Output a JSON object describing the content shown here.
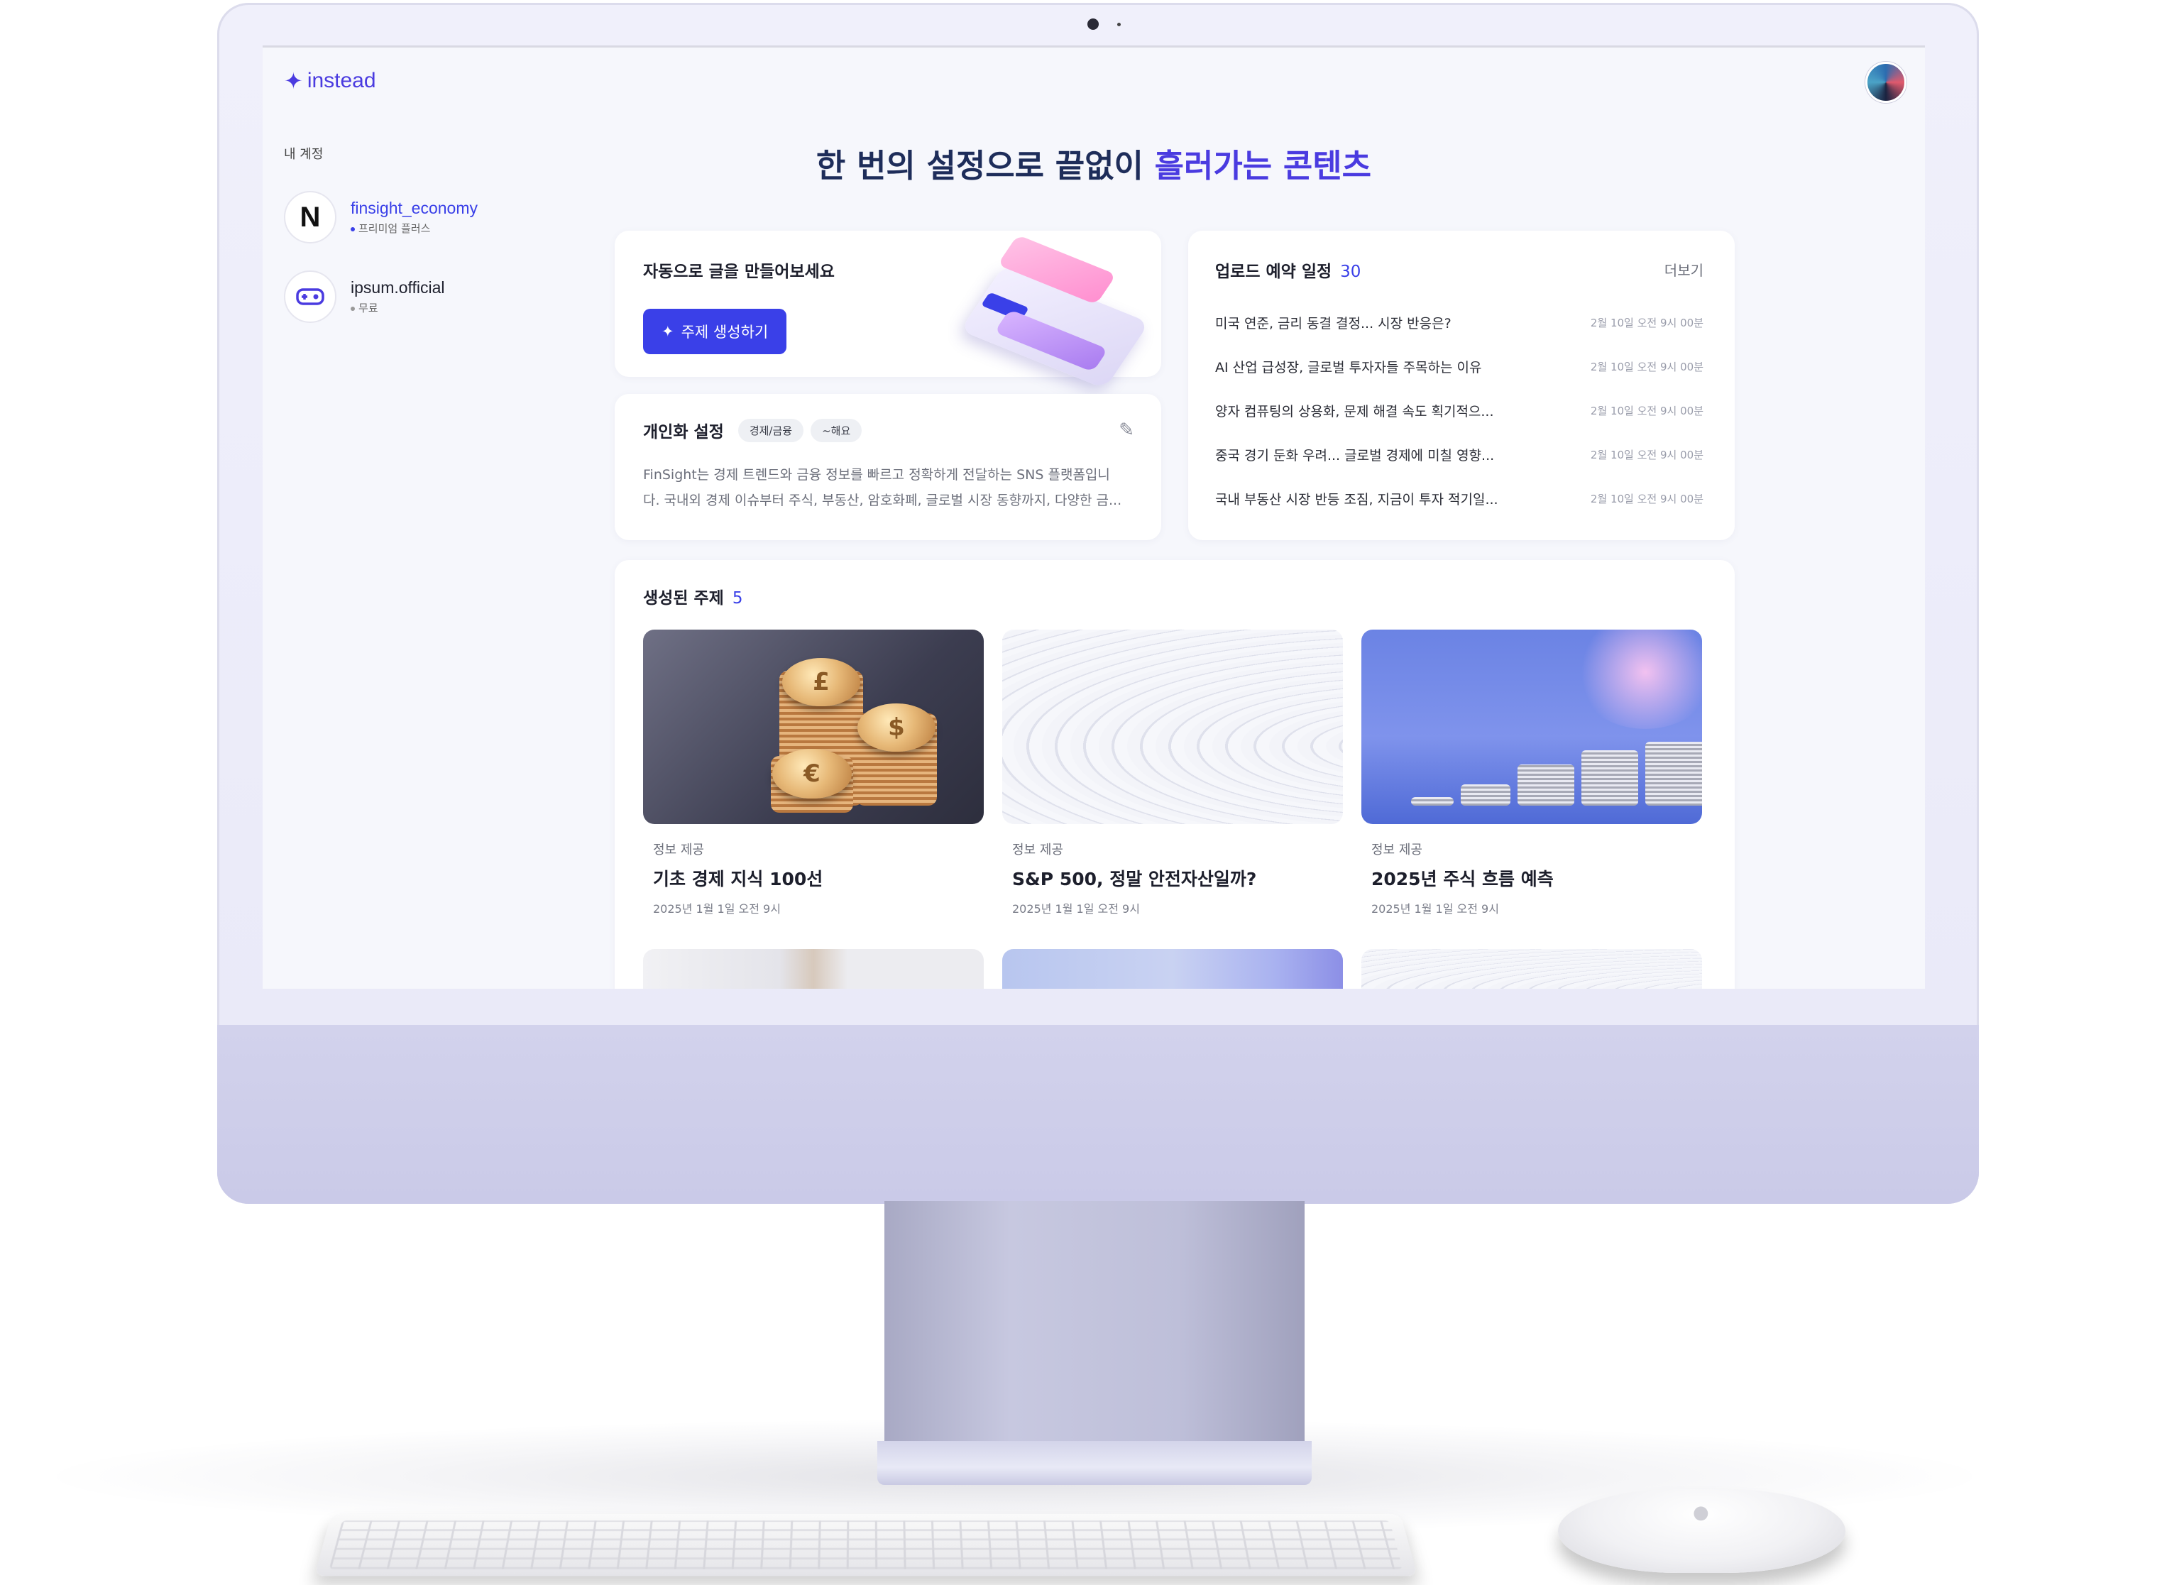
{
  "app": {
    "logo_text": "instead",
    "headline_part1": "한 번의 설정으로 끝없이 ",
    "headline_part2": "흘러가는 콘텐츠"
  },
  "sidebar": {
    "section_label": "내 계정",
    "accounts": [
      {
        "name": "finsight_economy",
        "plan": "프리미엄 플러스",
        "icon": "N",
        "active": true
      },
      {
        "name": "ipsum.official",
        "plan": "무료",
        "icon": "game-controller-icon",
        "active": false
      }
    ]
  },
  "auto_card": {
    "title": "자동으로 글을 만들어보세요",
    "button_label": "주제 생성하기"
  },
  "personal_card": {
    "title": "개인화 설정",
    "chips": [
      "경제/금융",
      "~해요"
    ],
    "desc_line1": "FinSight는 경제 트렌드와 금융 정보를 빠르고 정확하게 전달하는 SNS 플랫폼입니",
    "desc_line2": "다. 국내외 경제 이슈부터 주식, 부동산, 암호화폐, 글로벌 시장 동향까지, 다양한 금..."
  },
  "schedule": {
    "title": "업로드 예약 일정",
    "count": "30",
    "more_label": "더보기",
    "items": [
      {
        "title": "미국 연준, 금리 동결 결정... 시장 반응은?",
        "time": "2월 10일 오전 9시 00분"
      },
      {
        "title": "AI 산업 급성장, 글로벌 투자자들 주목하는 이유",
        "time": "2월 10일 오전 9시 00분"
      },
      {
        "title": "양자 컴퓨팅의 상용화, 문제 해결 속도 획기적으...",
        "time": "2월 10일 오전 9시 00분"
      },
      {
        "title": "중국 경기 둔화 우려... 글로벌 경제에 미칠 영향...",
        "time": "2월 10일 오전 9시 00분"
      },
      {
        "title": "국내 부동산 시장 반등 조짐, 지금이 투자 적기일...",
        "time": "2월 10일 오전 9시 00분"
      }
    ]
  },
  "topics": {
    "title": "생성된 주제",
    "count": "5",
    "items": [
      {
        "category": "정보 제공",
        "title": "기초 경제 지식 100선",
        "date": "2025년 1월 1일 오전 9시"
      },
      {
        "category": "정보 제공",
        "title": "S&P 500, 정말 안전자산일까?",
        "date": "2025년 1월 1일 오전 9시"
      },
      {
        "category": "정보 제공",
        "title": "2025년 주식 흐름 예측",
        "date": "2025년 1월 1일 오전 9시"
      }
    ]
  },
  "colors": {
    "accent": "#3a40e8",
    "brand": "#4a3be0",
    "headline": "#1e2d5a"
  }
}
